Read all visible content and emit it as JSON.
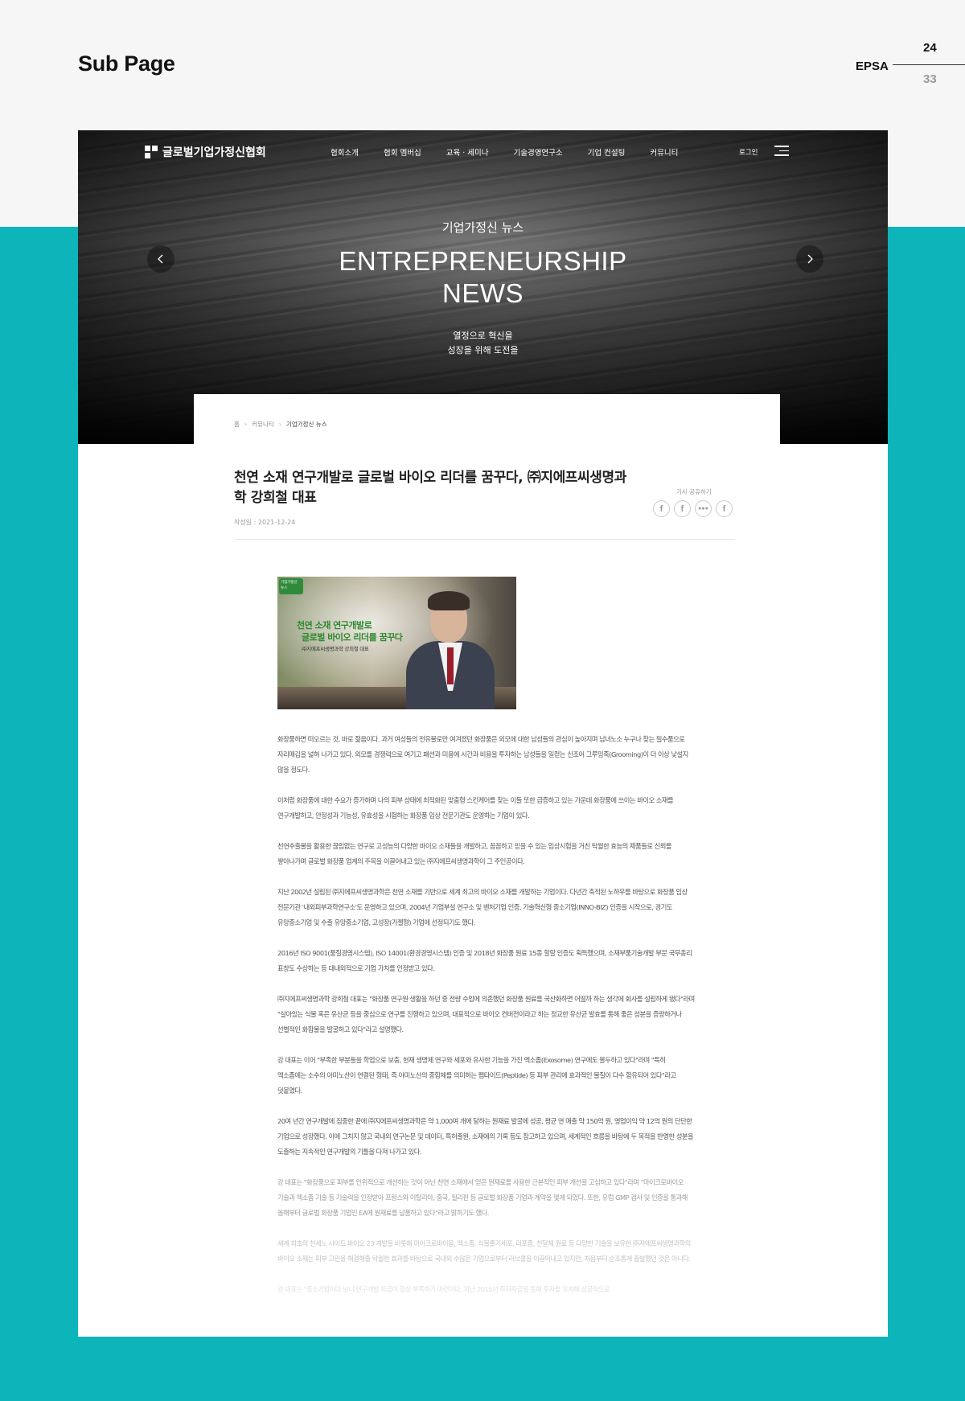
{
  "page": {
    "title": "Sub Page",
    "label": "EPSA",
    "current": "24",
    "total": "33"
  },
  "nav": {
    "logo_text": "글로벌기업가정신협회",
    "menu": [
      "협회소개",
      "협회 멤버십",
      "교육 · 세미나",
      "기술경영연구소",
      "기업 컨설팅",
      "커뮤니티"
    ],
    "login": "로그인"
  },
  "hero": {
    "kicker": "기업가정신 뉴스",
    "title_line1": "ENTREPRENEURSHIP",
    "title_line2": "NEWS",
    "sub_line1": "열정으로 혁신을",
    "sub_line2": "성장을 위해 도전을"
  },
  "breadcrumb": {
    "home": "홈",
    "level1": "커뮤니티",
    "level2": "기업가정신 뉴스"
  },
  "article": {
    "title": "천연 소재 연구개발로 글로벌 바이오 리더를 꿈꾸다, ㈜지에프씨생명과학 강희철 대표",
    "date": "작성일 : 2021-12-24",
    "share_label": "기사 공유하기",
    "image": {
      "badge": "기업가정신 뉴스",
      "line1": "천연 소재 연구개발로",
      "line2": "글로벌 바이오 리더를 꿈꾸다",
      "line3": "㈜지에프씨생명과학 강희철 대표"
    },
    "paragraphs": [
      "화장품하면 떠오르는 것, 바로 젊음이다. 과거 여성들의 전유물로만 여겨졌던 화장품은 외모에 대한 남성들의 관심이 높아지며 남녀노소 누구나 찾는 필수품으로 자리매김을 넓혀 나가고 있다. 외모를 경쟁력으로 여기고 패션과 미용에 시간과 비용을 투자하는 남성들을 일컫는 신조어 그루밍족(Grooming)이 더 이상 낯설지 않을 정도다.",
      "이처럼 화장품에 대한 수요가 증가하며 나의 피부 상태에 최적화된 맞춤형 스킨케어를 찾는 이들 또한 급증하고 있는 가운데 화장품에 쓰이는 바이오 소재를 연구개발하고, 안정성과 기능성, 유효성을 시험하는 화장품 임상 전문기관도 운영하는 기업이 있다.",
      "천연추출물을 활용한 끊임없는 연구로 고성능의 다양한 바이오 소재들을 개발하고, 꼼꼼하고 믿을 수 있는 임상시험을 거친 탁월한 효능의 제품들로 신뢰를 쌓아나가며 글로벌 화장품 업계의 주목을 이끌어내고 있는 ㈜지에프씨생명과학이 그 주인공이다.",
      "지난 2002년 설립된 ㈜지에프씨생명과학은 천연 소재를 기반으로 세계 최고의 바이오 소재를 개발하는 기업이다. 다년간 축적된 노하우를 바탕으로 화장품 임상 전문기관 '내외피부과학연구소'도 운영하고 있으며, 2004년 기업부설 연구소 및 벤처기업 인증, 기술혁신형 중소기업(INNO-BIZ) 인증을 시작으로, 경기도 유망중소기업 및 수출 유망중소기업, 고성장(가젤형) 기업에 선정되기도 했다.",
      "2016년 ISO 9001(품질경영시스템), ISO 14001(환경경영시스템) 인증 및 2018년 화장품 원료 15종 할랄 인증도 획득했으며, 소재부품기술개발 부문 국무총리 표창도 수상하는 등 대내외적으로 기업 가치를 인정받고 있다.",
      "㈜지에프씨생명과학 강희철 대표는 \"화장품 연구원 생활을 하던 중 전량 수입에 의존했던 화장품 원료를 국산화하면 어떨까 하는 생각에 회사를 설립하게 됐다\"라며 \"살아있는 식물 혹은 유산균 등을 중심으로 연구를 진행하고 있으며, 대표적으로 바이오 컨버전이라고 하는 정교한 유산균 발효를 통해 좋은 성분을 증량하거나 선별적인 화합물을 발굴하고 있다\"라고 설명했다.",
      "강 대표는 이어 \"부족한 부분들을 학업으로 보충, 현재 생명체 연구와 세포와 유사한 기능을 가진 엑소좀(Exosome) 연구에도 몰두하고 있다\"라며 \"특히 엑소좀에는 소수의 아미노산이 연결된 형태, 즉 아미노산의 중합체를 의미하는 펩타이드(Peptide) 등 피부 관리에 효과적인 물질이 다수 함유되어 있다\"라고 덧붙였다.",
      "20여 년간 연구개발에 집중한 끝에 ㈜지에프씨생명과학은 약 1,000여 개에 달하는 원재료 발굴에 성공, 평균 연 매출 약 150억 원, 영업이익 약 12억 원의 단단한 기업으로 성장했다. 이에 그치지 않고 국내외 연구논문 및 데이터, 특허출원, 소재에의 기록 등도 참고하고 있으며, 세계적인 흐름을 바탕에 두 목적을 반영한 성분을 도출하는 지속적인 연구개발의 기틀을 다져 나가고 있다.",
      "강 대표는 \"화장품으로 피부를 인위적으로 개선하는 것이 아닌 천연 소재에서 얻은 원재료를 사용한 근본적인 피부 개선을 고심하고 있다\"라며 \"마이크로바이오 기술과 엑소좀 기술 등 기술력을 인정받아 프랑스와 이탈리아, 중국, 필리핀 등 글로벌 화장품 기업과 계약을 맺게 되었다. 또한, 유럽 GMP 검사 및 인증을 통과해 올해부터 글로벌 화장품 기업인 EA에 원재료를 납품하고 있다\"라고 밝히기도 했다.",
      "세계 최초의 천세노 사이드 바이오 23 개발을 비롯해 마이크로바이옴, 엑소좀, 식물줄기세포, 리포좀, 천달체 원료 등 다양한 기술을 보유한 ㈜지에프씨생명과학의 바이오 소재는 피부 고민을 해결해줄 탁월한 효과를 바탕으로 국내외 수많은 기업으로부터 러브콜을 이끌어내고 있지만, 처음부터 순조롭게 출발했던 것은 아니다.",
      "강 대표는 \"중소기업이다 보니 연구개발 자금이 항상 부족하기 마련이다. 지난 2015년 투자자금을 통해 투자를 유치해 성공적으로"
    ]
  }
}
